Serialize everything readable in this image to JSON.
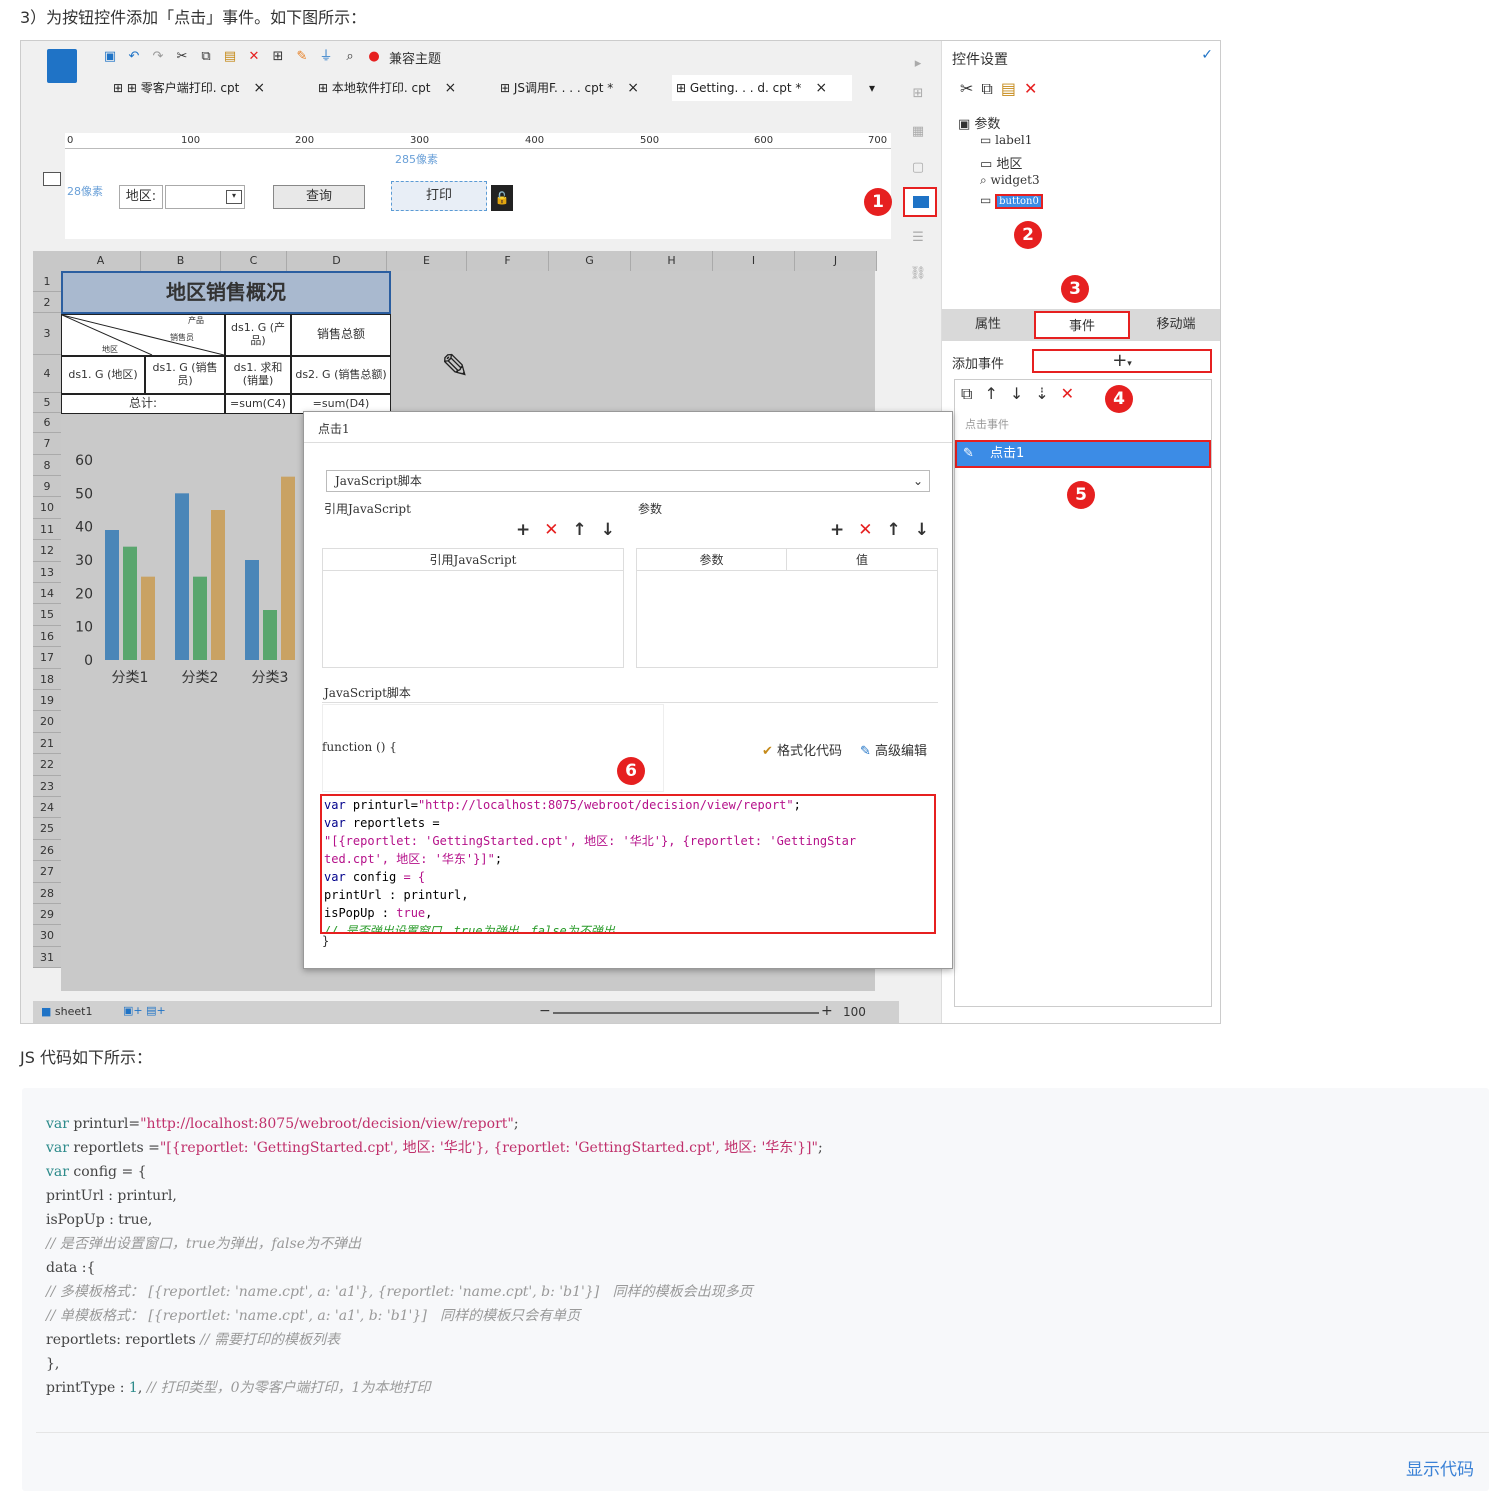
{
  "heading": "3）为按钮控件添加「点击」事件。如下图所示：",
  "toolbar": {
    "compat_theme": "兼容主题"
  },
  "tabs": [
    "零客户端打印. cpt",
    "本地软件打印. cpt",
    "JS调用F. . . . cpt *",
    "Getting. . . d. cpt *"
  ],
  "ruler": [
    "0",
    "100",
    "200",
    "300",
    "400",
    "500",
    "600",
    "700"
  ],
  "ruler_hint": "285像素",
  "param_panel": {
    "left_hint": "28像素",
    "region_label": "地区:",
    "query_btn": "查询",
    "print_btn": "打印"
  },
  "grid": {
    "cols": [
      "A",
      "B",
      "C",
      "D",
      "E",
      "F",
      "G",
      "H",
      "I",
      "J"
    ],
    "rows": [
      "1",
      "2",
      "3",
      "4",
      "5",
      "6",
      "7",
      "8",
      "9",
      "10",
      "11",
      "12",
      "13",
      "14",
      "15",
      "16",
      "17",
      "18",
      "19",
      "20",
      "21",
      "22",
      "23",
      "24",
      "25",
      "26",
      "27",
      "28",
      "29",
      "30",
      "31"
    ],
    "title": "地区销售概况",
    "h_product": "产品",
    "h_sales": "销售员",
    "h_region": "地区",
    "c3": "ds1. G (产品)",
    "d3": "销售总额",
    "a4": "ds1. G (地区)",
    "b4": "ds1. G (销售员)",
    "c4": "ds1. 求和 (销量)",
    "d4": "ds2. G (销售总额)",
    "a5": "总计:",
    "c5": "=sum(C4)",
    "d5": "=sum(D4)"
  },
  "chart_data": {
    "type": "bar",
    "categories": [
      "分类1",
      "分类2",
      "分类3"
    ],
    "series": [
      {
        "values": [
          39,
          50,
          30
        ]
      },
      {
        "values": [
          34,
          25,
          15
        ]
      },
      {
        "values": [
          25,
          45,
          55
        ]
      }
    ],
    "ylim": [
      0,
      60
    ],
    "yticks": [
      0,
      10,
      20,
      30,
      40,
      50,
      60
    ],
    "colors": [
      "#4a86b8",
      "#5aa66e",
      "#c9a263"
    ]
  },
  "sheet": {
    "name": "sheet1",
    "zoom": "100"
  },
  "right_panel": {
    "title": "控件设置",
    "tree": {
      "root": "参数",
      "items": [
        "label1",
        "地区",
        "widget3",
        "button0"
      ]
    },
    "tabs": [
      "属性",
      "事件",
      "移动端"
    ],
    "add_event": "添加事件",
    "event_group": "点击事件",
    "event_item": "点击1"
  },
  "dialog": {
    "title": "点击1",
    "type": "JavaScript脚本",
    "ref_js": "引用JavaScript",
    "params": "参数",
    "ref_js_col": "引用JavaScript",
    "param_col": "参数",
    "value_col": "值",
    "js_label": "JavaScript脚本",
    "function": "function () {",
    "format": "格式化代码",
    "advanced": "高级编辑",
    "close": "}",
    "code": [
      {
        "k": "var",
        "t": " printurl=",
        "s": "\"http://localhost:8075/webroot/decision/view/report\"",
        "e": ";"
      },
      {
        "k": "var",
        "t": " reportlets ="
      },
      {
        "s": "\"[{reportlet: 'GettingStarted.cpt', 地区: '华北'}, {reportlet: 'GettingStar"
      },
      {
        "s": "ted.cpt', 地区: '华东'}]\"",
        "e": ";"
      },
      {
        "k": "var",
        "t": " config ",
        "s": "= {"
      },
      {
        "t": "printUrl : printurl,"
      },
      {
        "t": "isPopUp : ",
        "s": "true",
        "e": ","
      },
      {
        "c": "// 是否弹出设置窗口，true为弹出，false为不弹出"
      }
    ]
  },
  "badges": [
    "1",
    "2",
    "3",
    "4",
    "5",
    "6"
  ],
  "js_intro": "JS 代码如下所示：",
  "js_code": [
    {
      "k": "var",
      "t": " printurl=",
      "s": "\"http://localhost:8075/webroot/decision/view/report\"",
      "e": ";"
    },
    {
      "k": "var",
      "t": " reportlets =",
      "s": "\"[{reportlet: 'GettingStarted.cpt', 地区: '华北'}, {reportlet: 'GettingStarted.cpt', 地区: '华东'}]\"",
      "e": ";"
    },
    {
      "k": "var",
      "t": " config = {"
    },
    {
      "t": "printUrl : printurl,"
    },
    {
      "t": "isPopUp : true,"
    },
    {
      "c": "// 是否弹出设置窗口，true为弹出，false为不弹出"
    },
    {
      "t": "data :{"
    },
    {
      "c": "// 多模板格式： [{reportlet: 'name.cpt', a: 'a1'}, {reportlet: 'name.cpt', b: 'b1'}]   同样的模板会出现多页"
    },
    {
      "c": "// 单模板格式： [{reportlet: 'name.cpt', a: 'a1', b: 'b1'}]   同样的模板只会有单页"
    },
    {
      "t": "reportlets: reportlets ",
      "c": "// 需要打印的模板列表"
    },
    {
      "t": "},"
    },
    {
      "t": "printType : ",
      "n": "1",
      "e": ", ",
      "c": "// 打印类型，0为零客户端打印，1为本地打印"
    }
  ],
  "show_code": "显示代码"
}
